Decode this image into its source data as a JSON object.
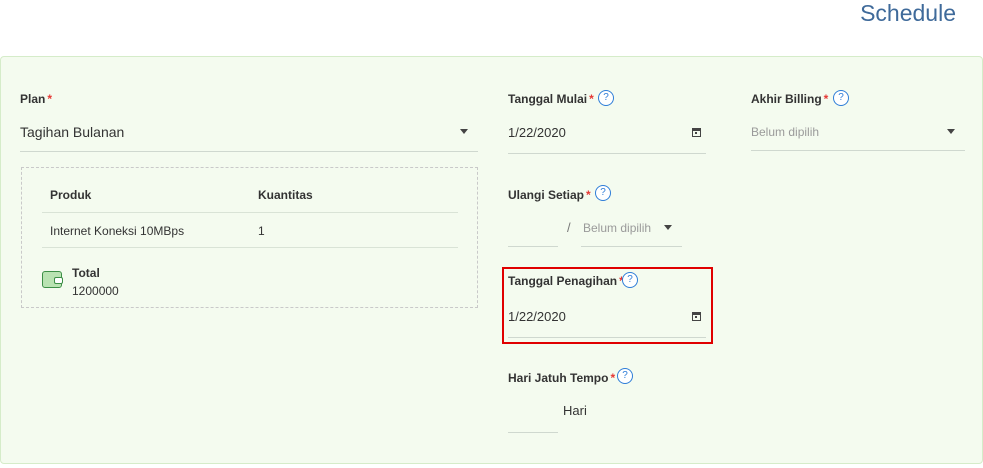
{
  "header": {
    "title": "Schedule"
  },
  "plan": {
    "label": "Plan",
    "required_mark": "*",
    "value": "Tagihan Bulanan"
  },
  "products": {
    "columns": [
      "Produk",
      "Kuantitas"
    ],
    "rows": [
      {
        "product": "Internet Koneksi 10MBps",
        "qty": "1"
      }
    ],
    "total_label": "Total",
    "total_value": "1200000"
  },
  "tanggal_mulai": {
    "label": "Tanggal Mulai",
    "required_mark": "*",
    "help": "?",
    "value": "1/22/2020"
  },
  "ulangi_setiap": {
    "label": "Ulangi Setiap",
    "required_mark": "*",
    "help": "?",
    "separator": "/",
    "placeholder": "Belum dipilih"
  },
  "tanggal_penagihan": {
    "label": "Tanggal Penagihan",
    "required_mark": "*",
    "help": "?",
    "value": "1/22/2020"
  },
  "hari_jatuh_tempo": {
    "label": "Hari Jatuh Tempo",
    "required_mark": "*",
    "help": "?",
    "unit": "Hari"
  },
  "akhir_billing": {
    "label": "Akhir Billing",
    "required_mark": "*",
    "help": "?",
    "placeholder": "Belum dipilih"
  },
  "colors": {
    "title": "#3f6a9a",
    "panel_bg": "#f4fbef",
    "required": "#e53935",
    "help": "#2f7ed8",
    "highlight": "#e00000"
  }
}
